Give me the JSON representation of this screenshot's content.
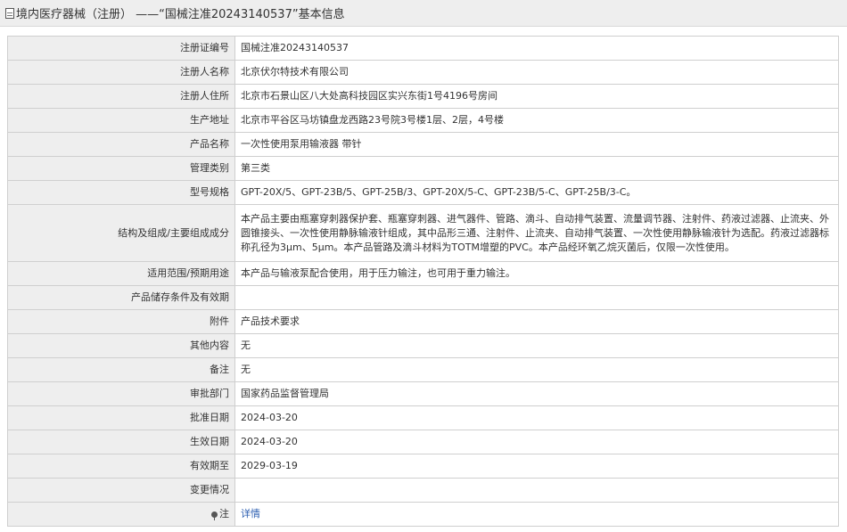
{
  "header": {
    "title": "境内医疗器械（注册） ——“国械注准20243140537”基本信息"
  },
  "fields": [
    {
      "label": "注册证编号",
      "value": "国械注准20243140537"
    },
    {
      "label": "注册人名称",
      "value": "北京伏尔特技术有限公司"
    },
    {
      "label": "注册人住所",
      "value": "北京市石景山区八大处高科技园区实兴东街1号4196号房间"
    },
    {
      "label": "生产地址",
      "value": "北京市平谷区马坊镇盘龙西路23号院3号楼1层、2层，4号楼"
    },
    {
      "label": "产品名称",
      "value": "一次性使用泵用输液器 带针"
    },
    {
      "label": "管理类别",
      "value": "第三类"
    },
    {
      "label": "型号规格",
      "value": "GPT-20X/5、GPT-23B/5、GPT-25B/3、GPT-20X/5-C、GPT-23B/5-C、GPT-25B/3-C。"
    },
    {
      "label": "结构及组成/主要组成成分",
      "value": "本产品主要由瓶塞穿刺器保护套、瓶塞穿刺器、进气器件、管路、滴斗、自动排气装置、流量调节器、注射件、药液过滤器、止流夹、外圆锥接头、一次性使用静脉输液针组成，其中品形三通、注射件、止流夹、自动排气装置、一次性使用静脉输液针为选配。药液过滤器标称孔径为3μm、5μm。本产品管路及滴斗材料为TOTM增塑的PVC。本产品经环氧乙烷灭菌后，仅限一次性使用。"
    },
    {
      "label": "适用范围/预期用途",
      "value": "本产品与输液泵配合使用，用于压力输注，也可用于重力输注。"
    },
    {
      "label": "产品储存条件及有效期",
      "value": ""
    },
    {
      "label": "附件",
      "value": "产品技术要求"
    },
    {
      "label": "其他内容",
      "value": "无"
    },
    {
      "label": "备注",
      "value": "无"
    },
    {
      "label": "审批部门",
      "value": "国家药品监督管理局"
    },
    {
      "label": "批准日期",
      "value": "2024-03-20"
    },
    {
      "label": "生效日期",
      "value": "2024-03-20"
    },
    {
      "label": "有效期至",
      "value": "2029-03-19"
    },
    {
      "label": "变更情况",
      "value": ""
    }
  ],
  "note": {
    "label": "注",
    "link_text": "详情",
    "icon": "pin-icon"
  }
}
